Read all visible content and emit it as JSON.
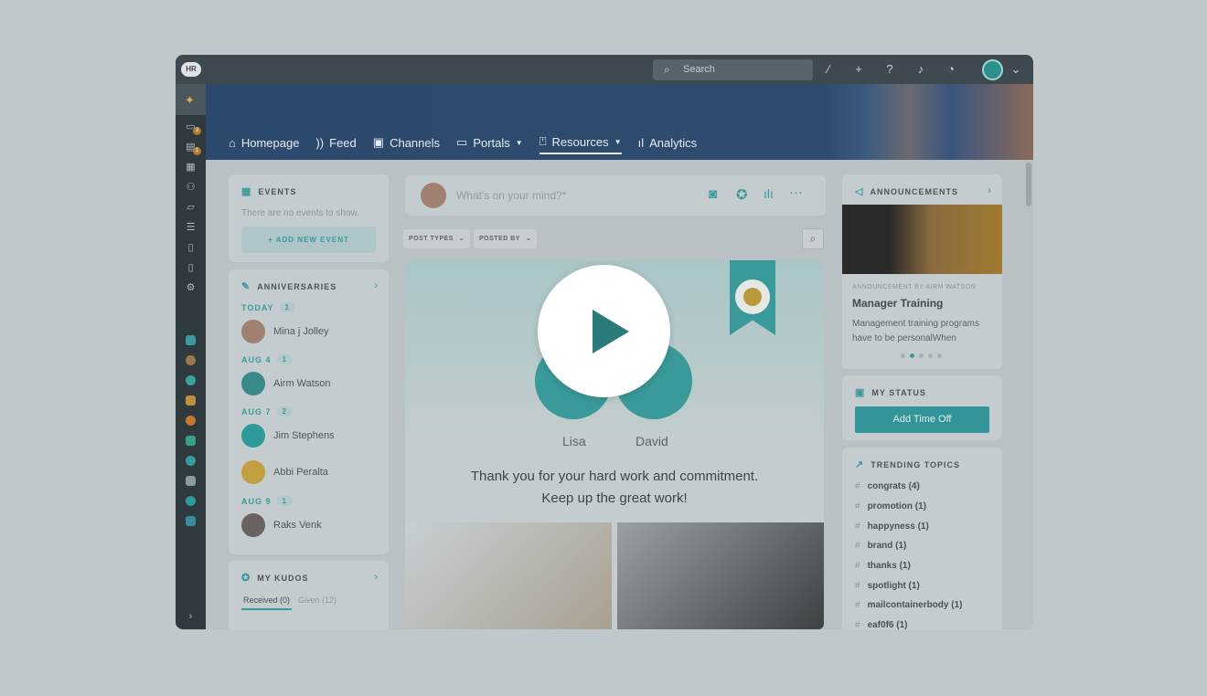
{
  "app": {
    "logo": "HR",
    "search_placeholder": "Search"
  },
  "sidebar": {
    "badges": [
      "3",
      "1"
    ]
  },
  "nav": [
    {
      "label": "Homepage",
      "icon": "home-icon"
    },
    {
      "label": "Feed",
      "icon": "rss-icon"
    },
    {
      "label": "Channels",
      "icon": "tv-icon"
    },
    {
      "label": "Portals",
      "icon": "card-icon",
      "dropdown": true
    },
    {
      "label": "Resources",
      "icon": "bookmark-icon",
      "dropdown": true,
      "active": true
    },
    {
      "label": "Analytics",
      "icon": "chart-icon"
    }
  ],
  "events": {
    "title": "EVENTS",
    "empty": "There are no events to show.",
    "add": "+ ADD NEW EVENT"
  },
  "anniversaries": {
    "title": "ANNIVERSARIES",
    "groups": [
      {
        "date": "TODAY",
        "count": "1",
        "people": [
          "Mina j Jolley"
        ]
      },
      {
        "date": "AUG 4",
        "count": "1",
        "people": [
          "Airm Watson"
        ]
      },
      {
        "date": "AUG 7",
        "count": "2",
        "people": [
          "Jim Stephens",
          "Abbi Peralta"
        ]
      },
      {
        "date": "AUG 9",
        "count": "1",
        "people": [
          "Raks Venk"
        ]
      }
    ]
  },
  "kudos": {
    "title": "MY KUDOS",
    "tabs": [
      "Received (0)",
      "Given (12)"
    ]
  },
  "composer": {
    "placeholder": "What's on your mind?*"
  },
  "filters": [
    "POST TYPES",
    "POSTED BY"
  ],
  "post": {
    "names": [
      "Lisa",
      "David"
    ],
    "message1": "Thank you for your hard work and commitment.",
    "message2": "Keep up the great work!"
  },
  "announcements": {
    "title": "ANNOUNCEMENTS",
    "by": "ANNOUNCEMENT BY AIRM WATSON",
    "heading": "Manager Training",
    "body": "Management training programs have to be personalWhen",
    "active_dot": 2,
    "dots": 5
  },
  "status": {
    "title": "MY STATUS",
    "button": "Add Time Off"
  },
  "trending": {
    "title": "TRENDING TOPICS",
    "topics": [
      "congrats (4)",
      "promotion (1)",
      "happyness (1)",
      "brand (1)",
      "thanks (1)",
      "spotlight (1)",
      "mailcontainerbody (1)",
      "eaf0f6 (1)"
    ]
  },
  "colors": {
    "accent": "#3a9a9a",
    "banner": "#2c4a6e",
    "play": "#2a7b7a"
  }
}
